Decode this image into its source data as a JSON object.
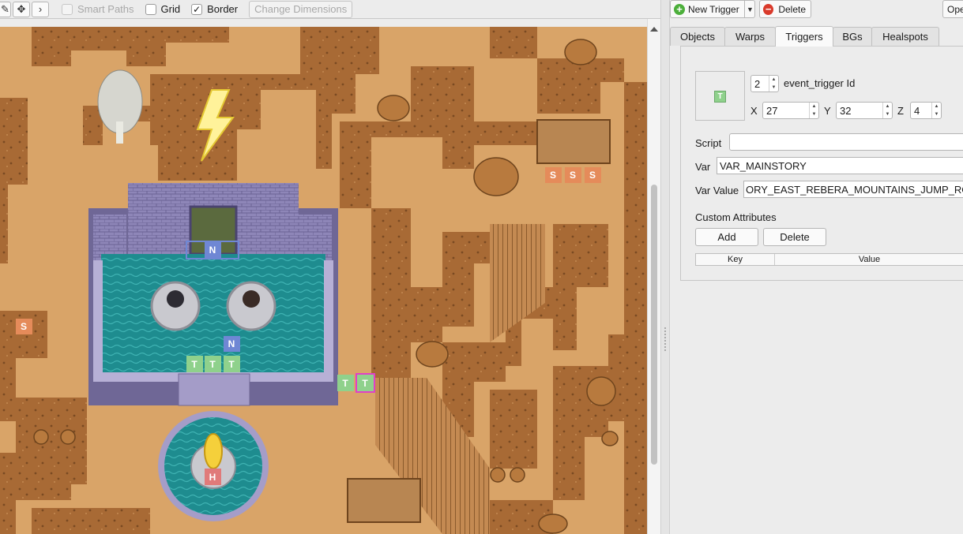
{
  "toolbar": {
    "smart_paths_label": "Smart Paths",
    "grid_label": "Grid",
    "border_label": "Border",
    "change_dimensions_label": "Change Dimensions",
    "smart_paths_checked": false,
    "grid_checked": false,
    "border_checked": true,
    "check_mark": "✓",
    "tool_icons": [
      "pencil-icon",
      "move-icon",
      "arrow-right-icon"
    ]
  },
  "right_toolbar": {
    "new_trigger_label": "New Trigger",
    "delete_label": "Delete",
    "open_label": "Ope"
  },
  "tabs": [
    {
      "label": "Objects"
    },
    {
      "label": "Warps"
    },
    {
      "label": "Triggers",
      "active": true
    },
    {
      "label": "BGs"
    },
    {
      "label": "Healspots"
    }
  ],
  "trigger": {
    "icon_letter": "T",
    "id_value": "2",
    "id_label": "event_trigger Id",
    "x_label": "X",
    "x_value": "27",
    "y_label": "Y",
    "y_value": "32",
    "z_label": "Z",
    "z_value": "4",
    "script_label": "Script",
    "script_value": "",
    "var_label": "Var",
    "var_value": "VAR_MAINSTORY",
    "var_value_label": "Var Value",
    "var_value_value": "ORY_EAST_REBERA_MOUNTAINS_JUMP_ROC",
    "custom_attributes_label": "Custom Attributes",
    "add_label": "Add",
    "delete_label": "Delete",
    "table_headers": [
      "Key",
      "Value"
    ]
  },
  "map": {
    "event_letters": {
      "trigger": "T",
      "sign": "S",
      "npc": "N",
      "heal": "H"
    },
    "colors": {
      "sand": "#d9a468",
      "cliff": "#a86a35",
      "cliff_dark": "#7a4a22",
      "water": "#1e8c8f",
      "stone": "#8e86b8",
      "trigger_tile": "#8fd18c",
      "sign_tile": "#e58b5a",
      "npc_tile": "#6f87d4",
      "heal_tile": "#e07a7a",
      "selected_outline": "#e040c8"
    }
  },
  "accent": {
    "green": "#4caf3b",
    "red": "#d93a2b"
  }
}
